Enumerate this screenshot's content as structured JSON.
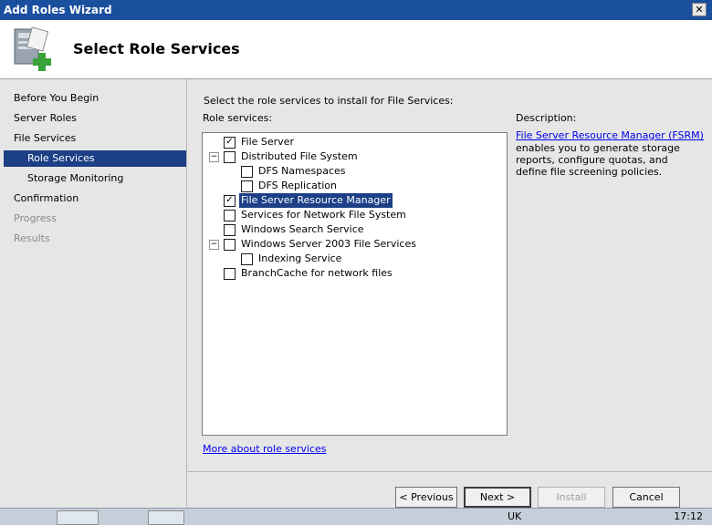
{
  "window": {
    "title": "Add Roles Wizard",
    "close_glyph": "✕"
  },
  "header": {
    "heading": "Select Role Services"
  },
  "nav": {
    "items": [
      {
        "label": "Before You Begin",
        "state": "normal"
      },
      {
        "label": "Server Roles",
        "state": "normal"
      },
      {
        "label": "File Services",
        "state": "normal"
      },
      {
        "label": "Role Services",
        "state": "active"
      },
      {
        "label": "Storage Monitoring",
        "state": "sub"
      },
      {
        "label": "Confirmation",
        "state": "normal"
      },
      {
        "label": "Progress",
        "state": "disabled"
      },
      {
        "label": "Results",
        "state": "disabled"
      }
    ]
  },
  "main": {
    "instruction": "Select the role services to install for File Services:",
    "role_services_label": "Role services:",
    "description_label": "Description:",
    "description_link": "File Server Resource Manager (FSRM)",
    "description_text": "enables you to generate storage reports, configure quotas, and define file screening policies.",
    "more_link": "More about role services",
    "services": [
      {
        "label": "File Server",
        "checked": true,
        "level": 0,
        "expander": false
      },
      {
        "label": "Distributed File System",
        "checked": false,
        "level": 0,
        "expander": true
      },
      {
        "label": "DFS Namespaces",
        "checked": false,
        "level": 1,
        "expander": false
      },
      {
        "label": "DFS Replication",
        "checked": false,
        "level": 1,
        "expander": false
      },
      {
        "label": "File Server Resource Manager",
        "checked": true,
        "level": 0,
        "expander": false,
        "selected": true
      },
      {
        "label": "Services for Network File System",
        "checked": false,
        "level": 0,
        "expander": false
      },
      {
        "label": "Windows Search Service",
        "checked": false,
        "level": 0,
        "expander": false
      },
      {
        "label": "Windows Server 2003 File Services",
        "checked": false,
        "level": 0,
        "expander": true
      },
      {
        "label": "Indexing Service",
        "checked": false,
        "level": 1,
        "expander": false
      },
      {
        "label": "BranchCache for network files",
        "checked": false,
        "level": 0,
        "expander": false
      }
    ]
  },
  "footer": {
    "previous": "< Previous",
    "next": "Next >",
    "install": "Install",
    "cancel": "Cancel"
  },
  "taskbar": {
    "lang": "UK",
    "clock": "17:12"
  },
  "colors": {
    "selection": "#1c3f86",
    "link": "#0000ee",
    "titlebar": "#1a4f9e"
  }
}
